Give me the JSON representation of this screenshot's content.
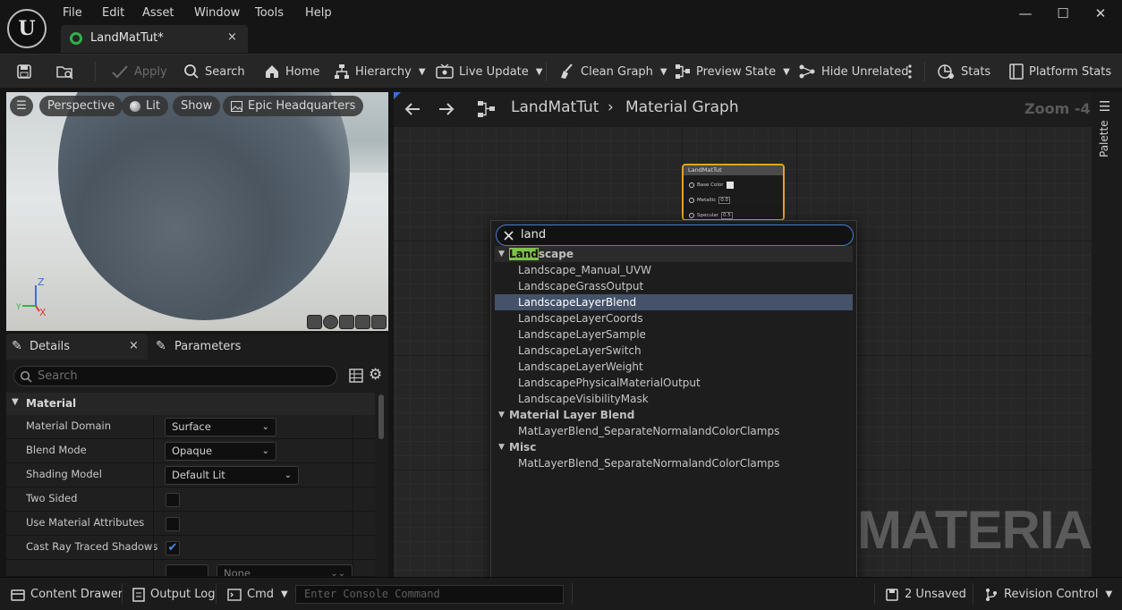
{
  "menu": [
    "File",
    "Edit",
    "Asset",
    "Window",
    "Tools",
    "Help"
  ],
  "window_controls": {
    "minimize": "—",
    "maximize": "☐",
    "close": "✕"
  },
  "asset_tab": {
    "label": "LandMatTut*",
    "close": "×"
  },
  "toolbar": {
    "apply": "Apply",
    "search": "Search",
    "home": "Home",
    "hierarchy": "Hierarchy",
    "live_update": "Live Update",
    "clean_graph": "Clean Graph",
    "preview_state": "Preview State",
    "hide_unrelated": "Hide Unrelated",
    "stats": "Stats",
    "platform_stats": "Platform Stats"
  },
  "viewport": {
    "perspective": "Perspective",
    "lit": "Lit",
    "show": "Show",
    "environment": "Epic Headquarters",
    "axis_z": "Z",
    "axis_x": "X",
    "axis_y": "Y"
  },
  "details": {
    "tab_details": "Details",
    "tab_details_close": "×",
    "tab_parameters": "Parameters",
    "search_placeholder": "Search",
    "category": "Material",
    "rows": [
      {
        "name": "Material Domain",
        "value": "Surface"
      },
      {
        "name": "Blend Mode",
        "value": "Opaque"
      },
      {
        "name": "Shading Model",
        "value": "Default Lit"
      },
      {
        "name": "Two Sided",
        "checked": false
      },
      {
        "name": "Use Material Attributes",
        "checked": false
      },
      {
        "name": "Cast Ray Traced Shadows",
        "checked": true
      }
    ],
    "partial_dropdown": "None"
  },
  "graph": {
    "breadcrumb_root": "LandMatTut",
    "breadcrumb_sep": "›",
    "breadcrumb_leaf": "Material Graph",
    "zoom": "Zoom -4",
    "watermark": "MATERIAL",
    "palette_label": "Palette",
    "node": {
      "title": "LandMatTut",
      "pins": [
        {
          "label": "Base Color",
          "value": ""
        },
        {
          "label": "Metallic",
          "value": "0.0"
        },
        {
          "label": "Specular",
          "value": "0.5"
        }
      ]
    }
  },
  "context_menu": {
    "search_value": "land",
    "sections": [
      {
        "category_highlight": "Land",
        "category_rest": "scape",
        "items": [
          "Landscape_Manual_UVW",
          "LandscapeGrassOutput",
          "LandscapeLayerBlend",
          "LandscapeLayerCoords",
          "LandscapeLayerSample",
          "LandscapeLayerSwitch",
          "LandscapeLayerWeight",
          "LandscapePhysicalMaterialOutput",
          "LandscapeVisibilityMask"
        ]
      },
      {
        "category": "Material Layer Blend",
        "items": [
          "MatLayerBlend_SeparateNormalandColorClamps"
        ]
      },
      {
        "category": "Misc",
        "items": [
          "MatLayerBlend_SeparateNormalandColorClamps"
        ]
      }
    ],
    "selected_item": "LandscapeLayerBlend"
  },
  "statusbar": {
    "content_drawer": "Content Drawer",
    "output_log": "Output Log",
    "cmd": "Cmd",
    "console_placeholder": "Enter Console Command",
    "unsaved": "2 Unsaved",
    "revision_control": "Revision Control"
  },
  "colors": {
    "accent_selection": "#44526a",
    "match_highlight": "#7cc24a",
    "node_border": "#e3a41b",
    "search_focus": "#4a7bd1",
    "asset_icon": "#2fb14a"
  }
}
